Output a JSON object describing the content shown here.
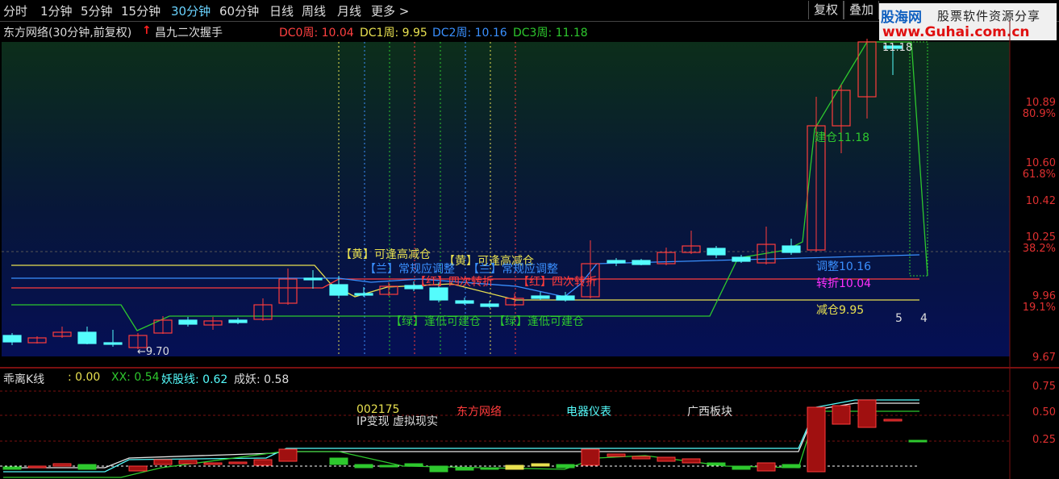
{
  "periods": [
    "分时",
    "1分钟",
    "5分钟",
    "15分钟",
    "30分钟",
    "60分钟",
    "日线",
    "周线",
    "月线",
    "更多 >"
  ],
  "active_period": "30分钟",
  "right_buttons": {
    "fuquan": "复权",
    "diejia": "叠加"
  },
  "watermark": {
    "brand": "股海网",
    "slogan": "股票软件资源分享",
    "url": "www.Guhai.com.cn"
  },
  "main_info": {
    "stock_title": "东方网络(30分钟,前复权)",
    "formula_name": "昌九二次握手",
    "dc0": "DC0周: 10.04",
    "dc1": "DC1周: 9.95",
    "dc2": "DC2周: 10.16",
    "dc3": "DC3周: 11.18"
  },
  "annotations": {
    "yellow1": "【黄】可逢高减仓",
    "yellow2": "【黄】可逢高减仓",
    "blue1": "【兰】常规应调整",
    "blue2": "【兰】常规应调整",
    "red1": "【红】四次转折",
    "red2": "【红】四次转折",
    "green1": "【绿】逢低可建仓",
    "green2": "【绿】逢低可建仓",
    "low_mark": "←9.70",
    "high_mark": "11.18",
    "jiancang": "建仓11.18",
    "tiaozheng": "调整10.16",
    "zhuanzhe": "转折10.04",
    "jiancang2": "减仓9.95",
    "num5": "5",
    "num4": "4"
  },
  "price_axis": [
    {
      "value": "10.89",
      "pct": "80.9%"
    },
    {
      "value": "10.60",
      "pct": "61.8%"
    },
    {
      "value": "10.42",
      "pct": ""
    },
    {
      "value": "10.25",
      "pct": "38.2%"
    },
    {
      "value": "9.96",
      "pct": "19.1%"
    },
    {
      "value": "9.67",
      "pct": ""
    }
  ],
  "sub_info": {
    "name": "乖离K线",
    "value": ": 0.00",
    "xx": "XX: 0.54",
    "yao": "妖股线: 0.62",
    "chengyao": "成妖: 0.58"
  },
  "sub_labels": {
    "code": "002175",
    "concept": "IP变现 虚拟现实",
    "stock": "东方网络",
    "industry": "电器仪表",
    "region": "广西板块"
  },
  "sub_axis": [
    "0.75",
    "0.50",
    "0.25"
  ],
  "colors": {
    "up": "#ff3c3c",
    "down": "#54fcfc",
    "yellow": "#e8e050",
    "blue": "#3a90ff",
    "green": "#2ec82e",
    "magenta": "#ff30ff"
  },
  "chart_data": {
    "type": "candlestick",
    "main_series": [
      {
        "name": "DC0周",
        "value": 10.04
      },
      {
        "name": "DC1周",
        "value": 9.95
      },
      {
        "name": "DC2周",
        "value": 10.16
      },
      {
        "name": "DC3周",
        "value": 11.18
      }
    ],
    "ylim": [
      9.67,
      11.18
    ],
    "sub_series": [
      {
        "name": "XX",
        "value": 0.54
      },
      {
        "name": "妖股线",
        "value": 0.62
      },
      {
        "name": "成妖",
        "value": 0.58
      }
    ],
    "sub_ylim": [
      0,
      0.75
    ]
  }
}
